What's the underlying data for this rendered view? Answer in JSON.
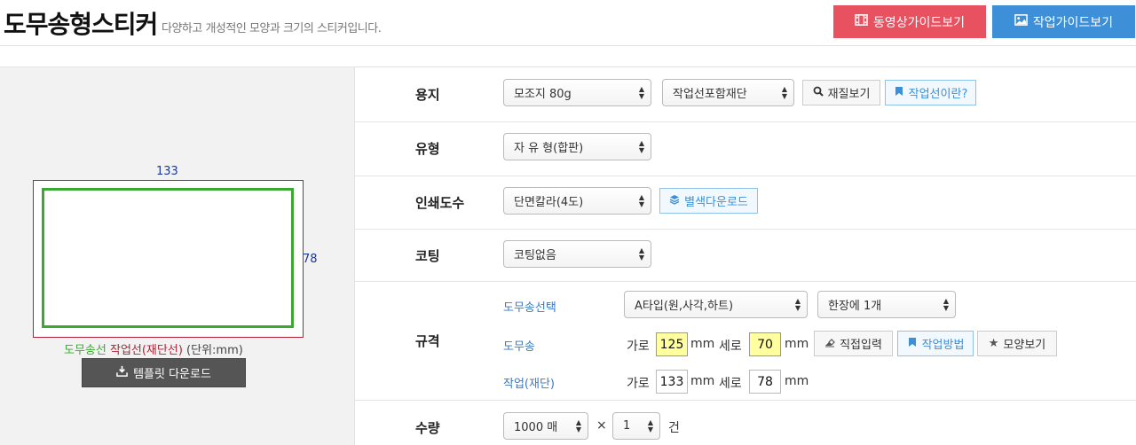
{
  "header": {
    "title": "도무송형스티커",
    "subtitle": "다양하고 개성적인 모양과 크기의 스티커입니다.",
    "video_guide_label": "동영상가이드보기",
    "work_guide_label": "작업가이드보기",
    "video_color": "#e8515f",
    "guide_color": "#3d8fd7"
  },
  "preview": {
    "width_value": "133",
    "height_value": "78",
    "legend_die": "도무송선",
    "legend_cut": "작업선(재단선)",
    "legend_unit": "(단위:mm)",
    "template_download_label": "템플릿 다운로드",
    "die_line_color": "#3aa932",
    "cut_line_color": "#b22234"
  },
  "options": {
    "paper": {
      "label": "용지",
      "paper_select": "모조지 80g",
      "cut_select": "작업선포함재단",
      "material_button": "재질보기",
      "workline_button": "작업선이란?"
    },
    "type": {
      "label": "유형",
      "type_select": "자 유 형(합판)"
    },
    "print_colors": {
      "label": "인쇄도수",
      "color_select": "단면칼라(4도)",
      "spot_download_button": "별색다운로드"
    },
    "coating": {
      "label": "코팅",
      "coating_select": "코팅없음"
    },
    "size": {
      "label": "규격",
      "die_select_label": "도무송선택",
      "die_select": "A타입(원,사각,하트)",
      "per_sheet_select": "한장에 1개",
      "die_label": "도무송",
      "width_label": "가로",
      "die_width": "125",
      "height_label": "세로",
      "die_height": "70",
      "unit": "mm",
      "direct_input_button": "직접입력",
      "work_method_button": "작업방법",
      "shape_view_button": "모양보기",
      "work_label": "작업(재단)",
      "work_width": "133",
      "work_height": "78"
    },
    "quantity": {
      "label": "수량",
      "qty_select": "1000 매",
      "times": "×",
      "count_select": "1",
      "count_unit": "건"
    }
  }
}
